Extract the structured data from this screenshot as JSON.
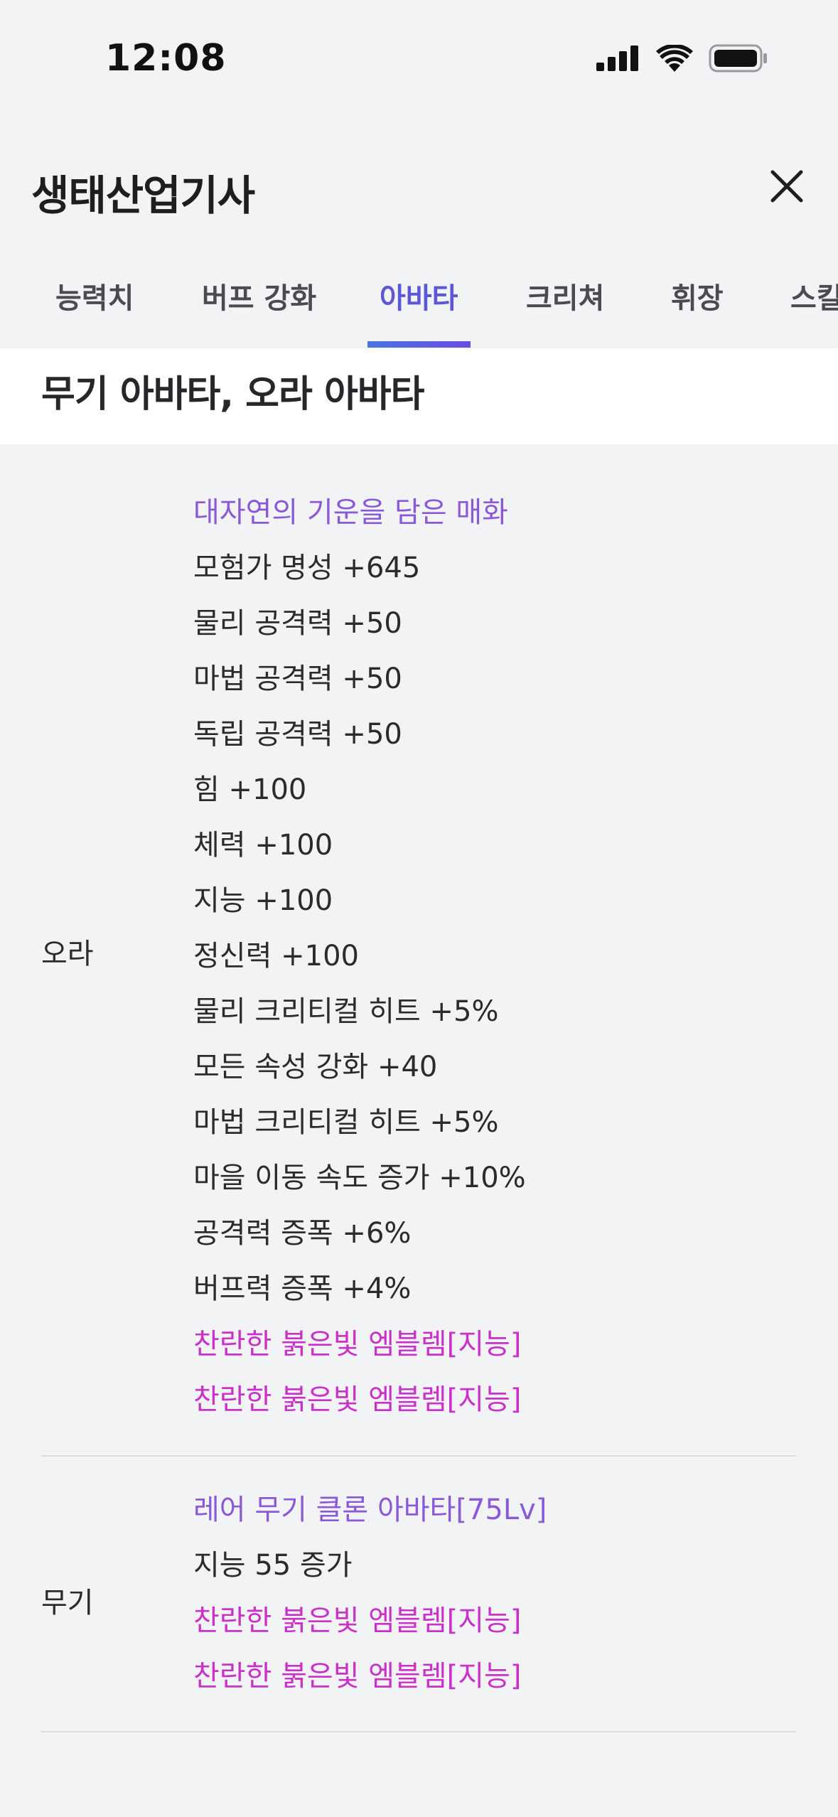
{
  "status_bar": {
    "time": "12:08"
  },
  "header": {
    "title": "생태산업기사"
  },
  "tabs": [
    {
      "label": "능력치",
      "active": false
    },
    {
      "label": "버프 강화",
      "active": false
    },
    {
      "label": "아바타",
      "active": true
    },
    {
      "label": "크리쳐",
      "active": false
    },
    {
      "label": "휘장",
      "active": false
    },
    {
      "label": "스킬",
      "active": false
    }
  ],
  "section": {
    "title": "무기 아바타, 오라 아바타"
  },
  "groups": [
    {
      "label": "오라",
      "lines": [
        {
          "text": "대자연의 기운을 담은 매화",
          "color": "#8a59d8"
        },
        {
          "text": "모험가 명성 +645"
        },
        {
          "text": "물리 공격력 +50"
        },
        {
          "text": "마법 공격력 +50"
        },
        {
          "text": "독립 공격력 +50"
        },
        {
          "text": "힘 +100"
        },
        {
          "text": "체력 +100"
        },
        {
          "text": "지능 +100"
        },
        {
          "text": "정신력 +100"
        },
        {
          "text": "물리 크리티컬 히트 +5%"
        },
        {
          "text": "모든 속성 강화 +40"
        },
        {
          "text": "마법 크리티컬 히트 +5%"
        },
        {
          "text": "마을 이동 속도 증가 +10%"
        },
        {
          "text": "공격력 증폭 +6%"
        },
        {
          "text": "버프력 증폭 +4%"
        },
        {
          "text": "찬란한 붉은빛 엠블렘[지능]",
          "color": "#c931c9"
        },
        {
          "text": "찬란한 붉은빛 엠블렘[지능]",
          "color": "#c931c9"
        }
      ]
    },
    {
      "label": "무기",
      "lines": [
        {
          "text": "레어 무기 클론 아바타[75Lv]",
          "color": "#8a59d8"
        },
        {
          "text": "지능 55 증가"
        },
        {
          "text": "찬란한 붉은빛 엠블렘[지능]",
          "color": "#c931c9"
        },
        {
          "text": "찬란한 붉은빛 엠블렘[지능]",
          "color": "#c931c9"
        }
      ]
    }
  ],
  "colors": {
    "accent": "#5b57d6",
    "rare": "#8a59d8",
    "emblem": "#c931c9"
  }
}
